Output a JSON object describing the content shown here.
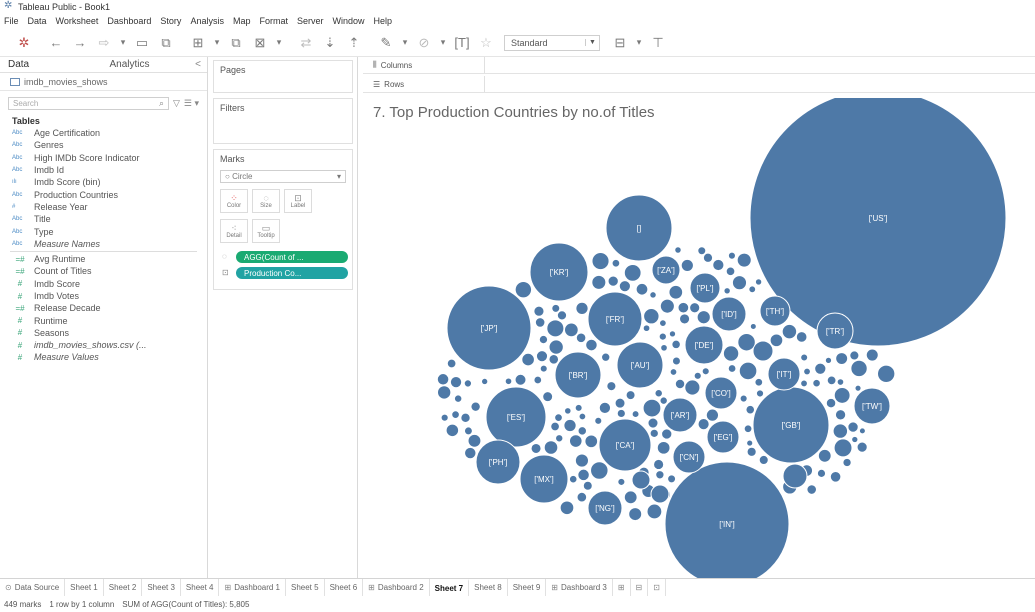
{
  "window": {
    "title": "Tableau Public - Book1"
  },
  "menu": [
    "File",
    "Data",
    "Worksheet",
    "Dashboard",
    "Story",
    "Analysis",
    "Map",
    "Format",
    "Server",
    "Window",
    "Help"
  ],
  "toolbar": {
    "view_mode": "Standard"
  },
  "data_pane": {
    "tab_data": "Data",
    "tab_analytics": "Analytics",
    "collapse": "<",
    "datasource": "imdb_movies_shows",
    "search_placeholder": "Search",
    "tables_heading": "Tables",
    "dimensions": [
      {
        "type": "Abc",
        "name": "Age Certification"
      },
      {
        "type": "Abc",
        "name": "Genres"
      },
      {
        "type": "Abc",
        "name": "High IMDb Score Indicator"
      },
      {
        "type": "Abc",
        "name": "Imdb Id"
      },
      {
        "type": "ılı",
        "name": "Imdb Score (bin)"
      },
      {
        "type": "Abc",
        "name": "Production Countries"
      },
      {
        "type": "#",
        "name": "Release Year"
      },
      {
        "type": "Abc",
        "name": "Title"
      },
      {
        "type": "Abc",
        "name": "Type"
      },
      {
        "type": "Abc",
        "name": "Measure Names",
        "italic": true
      }
    ],
    "measures": [
      {
        "type": "=#",
        "name": "Avg Runtime"
      },
      {
        "type": "=#",
        "name": "Count of Titles"
      },
      {
        "type": "#",
        "name": "Imdb Score"
      },
      {
        "type": "#",
        "name": "Imdb Votes"
      },
      {
        "type": "=#",
        "name": "Release Decade"
      },
      {
        "type": "#",
        "name": "Runtime"
      },
      {
        "type": "#",
        "name": "Seasons"
      },
      {
        "type": "#",
        "name": "imdb_movies_shows.csv (...",
        "italic": true
      },
      {
        "type": "#",
        "name": "Measure Values",
        "italic": true
      }
    ]
  },
  "shelves": {
    "pages": "Pages",
    "filters": "Filters",
    "marks": "Marks",
    "mark_type": "Circle",
    "mark_buttons": [
      {
        "label": "Color",
        "icon": "color-dots-icon"
      },
      {
        "label": "Size",
        "icon": "size-icon"
      },
      {
        "label": "Label",
        "icon": "label-icon"
      },
      {
        "label": "Detail",
        "icon": "detail-icon"
      },
      {
        "label": "Tooltip",
        "icon": "tooltip-icon"
      }
    ],
    "pill_size": "AGG(Count of ...",
    "pill_label": "Production Co...",
    "columns": "Columns",
    "rows": "Rows",
    "pill_colors": {
      "green": "#1aaa72",
      "teal": "#21a3a3"
    }
  },
  "viz": {
    "title": "7. Top Production Countries by no.of Titles",
    "bubble_color": "#4e79a7",
    "bubble_stroke": "#ffffff"
  },
  "chart_data": {
    "type": "packed-bubble",
    "title": "7. Top Production Countries by no.of Titles",
    "measure": "Count of Titles",
    "total": 5805,
    "labeled_bubbles": [
      {
        "label": "['US']",
        "value": 2300
      },
      {
        "label": "['IN']",
        "value": 610
      },
      {
        "label": "['GB']",
        "value": 320
      },
      {
        "label": "['JP']",
        "value": 300
      },
      {
        "label": "[]",
        "value": 230
      },
      {
        "label": "['ES']",
        "value": 210
      },
      {
        "label": "['KR']",
        "value": 200
      },
      {
        "label": "['FR']",
        "value": 170
      },
      {
        "label": "['CA']",
        "value": 150
      },
      {
        "label": "['MX']",
        "value": 130
      },
      {
        "label": "['BR']",
        "value": 120
      },
      {
        "label": "['AU']",
        "value": 110
      },
      {
        "label": "['PH']",
        "value": 100
      },
      {
        "label": "['DE']",
        "value": 80
      },
      {
        "label": "['TR']",
        "value": 75
      },
      {
        "label": "['NG']",
        "value": 70
      },
      {
        "label": "['TW']",
        "value": 65
      },
      {
        "label": "['ID']",
        "value": 60
      },
      {
        "label": "['IT']",
        "value": 58
      },
      {
        "label": "['CO']",
        "value": 55
      },
      {
        "label": "['AR']",
        "value": 55
      },
      {
        "label": "['EG']",
        "value": 50
      },
      {
        "label": "['CN']",
        "value": 50
      },
      {
        "label": "['TH']",
        "value": 45
      },
      {
        "label": "['PL']",
        "value": 40
      },
      {
        "label": "['ZA']",
        "value": 35
      }
    ]
  },
  "sheet_tabs": [
    {
      "label": "Data Source",
      "icon": "datasource-icon"
    },
    {
      "label": "Sheet 1"
    },
    {
      "label": "Sheet 2"
    },
    {
      "label": "Sheet 3"
    },
    {
      "label": "Sheet 4"
    },
    {
      "label": "Dashboard 1",
      "icon": "dashboard-icon"
    },
    {
      "label": "Sheet 5"
    },
    {
      "label": "Sheet 6"
    },
    {
      "label": "Dashboard 2",
      "icon": "dashboard-icon"
    },
    {
      "label": "Sheet 7",
      "active": true
    },
    {
      "label": "Sheet 8"
    },
    {
      "label": "Sheet 9"
    },
    {
      "label": "Dashboard 3",
      "icon": "dashboard-icon"
    }
  ],
  "status": {
    "marks": "449 marks",
    "rows_cols": "1 row by 1 column",
    "sum": "SUM of AGG(Count of Titles): 5,805"
  }
}
